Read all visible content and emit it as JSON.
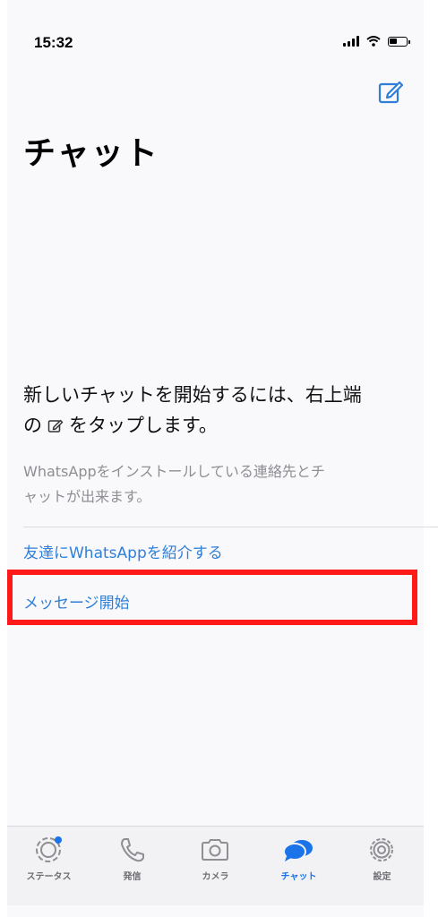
{
  "status_bar": {
    "time": "15:32"
  },
  "header": {
    "title": "チャット"
  },
  "empty_state": {
    "line1": "新しいチャットを開始するには、右上端",
    "line2_prefix": "の",
    "line2_suffix": "をタップします。",
    "sub_line1": "WhatsAppをインストールしている連絡先とチ",
    "sub_line2": "ャットが出来ます。"
  },
  "actions": {
    "invite": "友達にWhatsAppを紹介する",
    "start_message": "メッセージ開始"
  },
  "tabs": [
    {
      "label": "ステータス",
      "icon": "status-icon"
    },
    {
      "label": "発信",
      "icon": "phone-icon"
    },
    {
      "label": "カメラ",
      "icon": "camera-icon"
    },
    {
      "label": "チャット",
      "icon": "chats-icon",
      "active": true
    },
    {
      "label": "設定",
      "icon": "gear-icon"
    }
  ],
  "colors": {
    "accent": "#2f7fd8",
    "highlight": "#ff1a1a",
    "tab_active": "#1a73e8"
  }
}
